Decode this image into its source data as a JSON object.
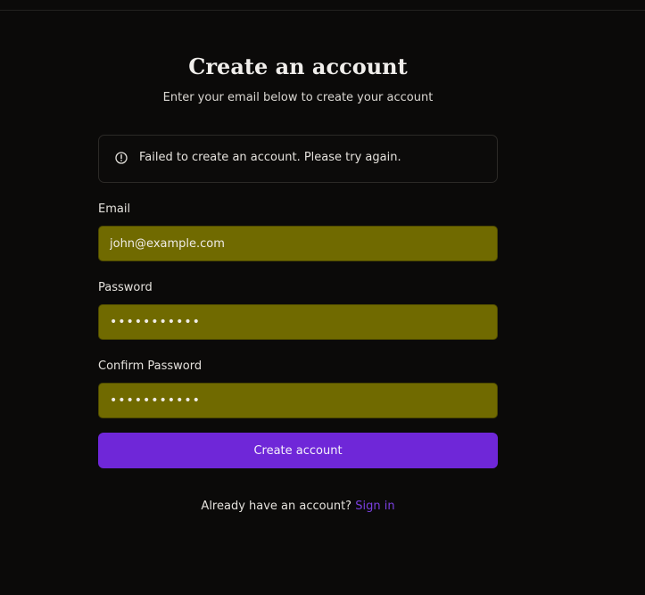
{
  "heading": {
    "title": "Create an account",
    "subtitle": "Enter your email below to create your account"
  },
  "alert": {
    "icon": "alert-circle-icon",
    "message": "Failed to create an account. Please try again."
  },
  "fields": {
    "email": {
      "label": "Email",
      "value": "john@example.com"
    },
    "password": {
      "label": "Password",
      "value": "•••••••••••"
    },
    "confirm_password": {
      "label": "Confirm Password",
      "value": "•••••••••••"
    }
  },
  "submit_label": "Create account",
  "footer": {
    "prompt": "Already have an account?",
    "link": "Sign in"
  },
  "colors": {
    "background": "#0b0a09",
    "input_fill": "#706a00",
    "accent": "#6f27d8",
    "link": "#7a3fe0"
  }
}
